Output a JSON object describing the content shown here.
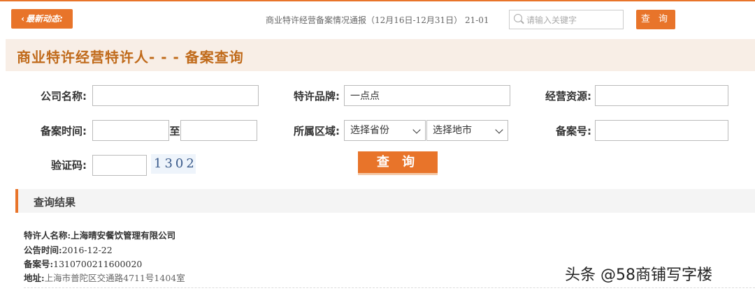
{
  "topbar": {
    "latest_label": "最新动态:",
    "ticker_text": "商业特许经营备案情况通报（12月16日-12月31日） 21-01",
    "search_placeholder": "请输入关键字",
    "query_label": "查 询"
  },
  "page_title": "商业特许经营特许人- - - 备案查询",
  "form": {
    "company_label": "公司名称:",
    "company_value": "",
    "brand_label": "特许品牌:",
    "brand_value": "一点点",
    "resource_label": "经营资源:",
    "resource_value": "",
    "date_label": "备案时间:",
    "date_from": "",
    "date_to_label": "至",
    "date_to": "",
    "region_label": "所属区域:",
    "province_select": "选择省份",
    "city_select": "选择地市",
    "record_no_label": "备案号:",
    "record_no_value": "",
    "captcha_label": "验证码:",
    "captcha_value": "",
    "captcha_image_text": "1302",
    "submit_label": "查 询"
  },
  "results": {
    "section_title": "查询结果",
    "items": [
      {
        "franchisor_label": "特许人名称:",
        "franchisor_value": "上海晴安餐饮管理有限公司",
        "announce_label": "公告时间:",
        "announce_value": "2016-12-22",
        "record_label": "备案号:",
        "record_value": "1310700211600020",
        "address_label": "地址:",
        "address_value": "上海市普陀区交通路4711号1404室"
      }
    ]
  },
  "watermark": "头条 @58商铺写字楼",
  "colors": {
    "accent": "#e8742a",
    "title_bg": "#f8eee6",
    "title_text": "#c06a1a"
  }
}
